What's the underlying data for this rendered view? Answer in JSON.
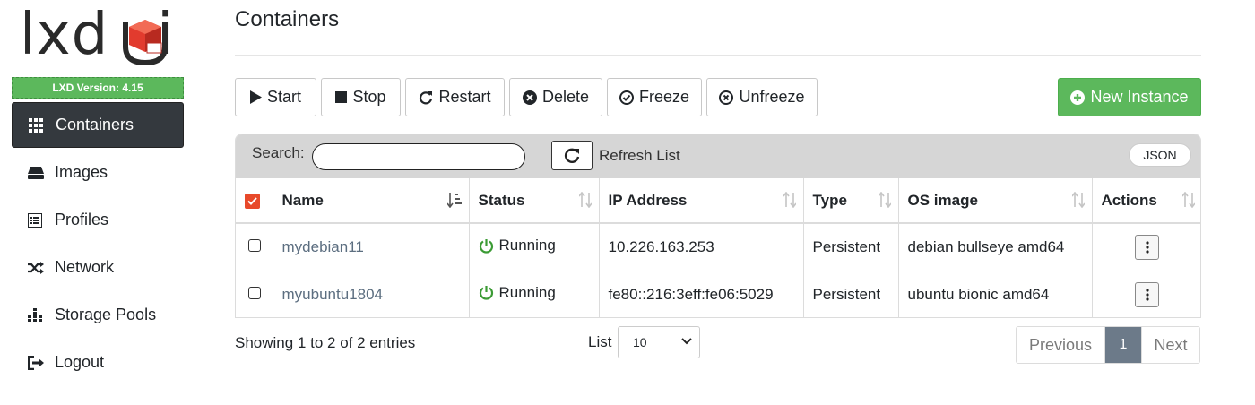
{
  "brand": {
    "logo_text": "lxd",
    "logo_suffix": "i",
    "version_label": "LXD Version: 4.15"
  },
  "sidebar": {
    "items": [
      {
        "label": "Containers",
        "icon": "grid-icon",
        "active": true
      },
      {
        "label": "Images",
        "icon": "hard-drive-icon",
        "active": false
      },
      {
        "label": "Profiles",
        "icon": "list-icon",
        "active": false
      },
      {
        "label": "Network",
        "icon": "shuffle-icon",
        "active": false
      },
      {
        "label": "Storage Pools",
        "icon": "database-icon",
        "active": false
      },
      {
        "label": "Logout",
        "icon": "sign-out-icon",
        "active": false
      }
    ]
  },
  "page": {
    "title": "Containers"
  },
  "toolbar": {
    "start": "Start",
    "stop": "Stop",
    "restart": "Restart",
    "delete": "Delete",
    "freeze": "Freeze",
    "unfreeze": "Unfreeze",
    "new_instance": "New Instance"
  },
  "panel": {
    "search_label": "Search:",
    "search_value": "",
    "refresh_label": "Refresh List",
    "json_label": "JSON"
  },
  "table": {
    "columns": [
      "Name",
      "Status",
      "IP Address",
      "Type",
      "OS image",
      "Actions"
    ],
    "rows": [
      {
        "name": "mydebian11",
        "status": "Running",
        "ip": "10.226.163.253",
        "type": "Persistent",
        "os": "debian bullseye amd64"
      },
      {
        "name": "myubuntu1804",
        "status": "Running",
        "ip": "fe80::216:3eff:fe06:5029",
        "type": "Persistent",
        "os": "ubuntu bionic amd64"
      }
    ]
  },
  "footer": {
    "info": "Showing 1 to 2 of 2 entries",
    "list_label": "List",
    "page_size": "10",
    "previous": "Previous",
    "current_page": "1",
    "next": "Next"
  },
  "colors": {
    "accent_green": "#5cb85c",
    "active_nav": "#34393e",
    "checkbox_red": "#e8492a",
    "status_green": "#3c9b35",
    "link": "#5c6e80",
    "page_active": "#6c7a89"
  }
}
